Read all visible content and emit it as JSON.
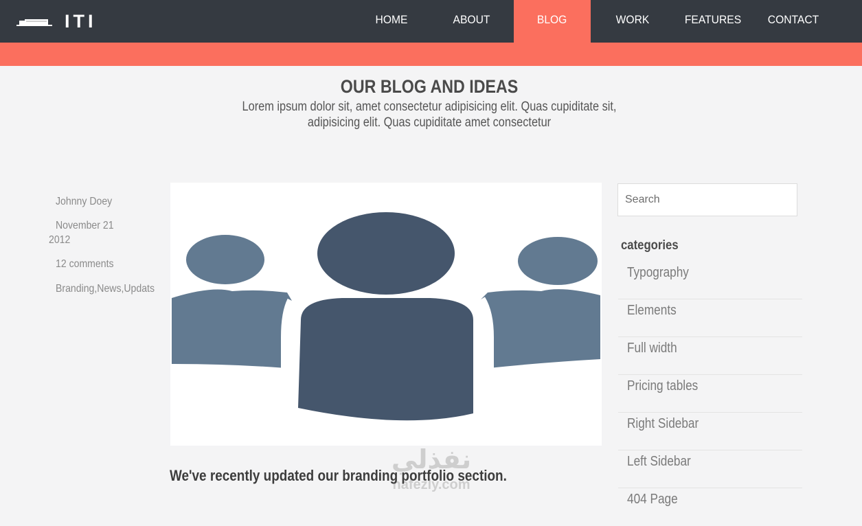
{
  "header": {
    "brand": "ITI",
    "nav": [
      {
        "label": "HOME",
        "active": false
      },
      {
        "label": "ABOUT",
        "active": false
      },
      {
        "label": "BLOG",
        "active": true
      },
      {
        "label": "WORK",
        "active": false
      },
      {
        "label": "FEATURES",
        "active": false
      },
      {
        "label": "CONTACT",
        "active": false
      }
    ]
  },
  "section": {
    "title": "OUR BLOG AND IDEAS",
    "subtitle_line1": "Lorem ipsum dolor sit, amet consectetur adipisicing elit. Quas cupiditate sit,",
    "subtitle_line2": "adipisicing elit. Quas cupiditate amet consectetur"
  },
  "post": {
    "meta": {
      "author": "Johnny Doey",
      "date_line1": "November 21",
      "date_line2": "2012",
      "comments": "12 comments",
      "tags": "Branding,News,Updats"
    },
    "image_icon": "group-of-people-icon",
    "title": "We've recently updated our branding portfolio section."
  },
  "sidebar": {
    "search": {
      "placeholder": "Search",
      "value": ""
    },
    "categories_heading": "categories",
    "categories": [
      {
        "label": "Typography"
      },
      {
        "label": "Elements"
      },
      {
        "label": "Full width"
      },
      {
        "label": "Pricing tables"
      },
      {
        "label": "Right Sidebar"
      },
      {
        "label": "Left Sidebar"
      },
      {
        "label": "404 Page"
      }
    ]
  },
  "watermark": {
    "arabic": "نفذلي",
    "latin": "nafezly.com"
  },
  "colors": {
    "header_bg": "#353a41",
    "accent": "#fb6f5e",
    "page_bg": "#f4f4f5",
    "icon_light": "#627a91",
    "icon_dark": "#45566c"
  }
}
